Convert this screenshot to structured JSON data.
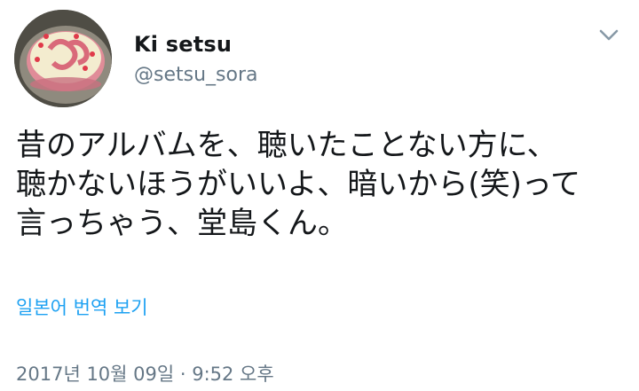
{
  "author": {
    "display_name": "Ki setsu",
    "handle": "@setsu_sora"
  },
  "tweet": {
    "lines": [
      "昔のアルバムを、聴いたことない方に、",
      "聴かないほうがいいよ、暗いから(笑)って",
      "言っちゃう、堂島くん。"
    ],
    "translate_link": "일본어 번역 보기",
    "timestamp": "2017년 10월 09일 · 9:52 오후"
  },
  "icons": {
    "menu": "chevron-down-icon",
    "avatar": "cake-photo"
  },
  "colors": {
    "link": "#1da1f2",
    "secondary_text": "#657786",
    "primary_text": "#14171a"
  }
}
